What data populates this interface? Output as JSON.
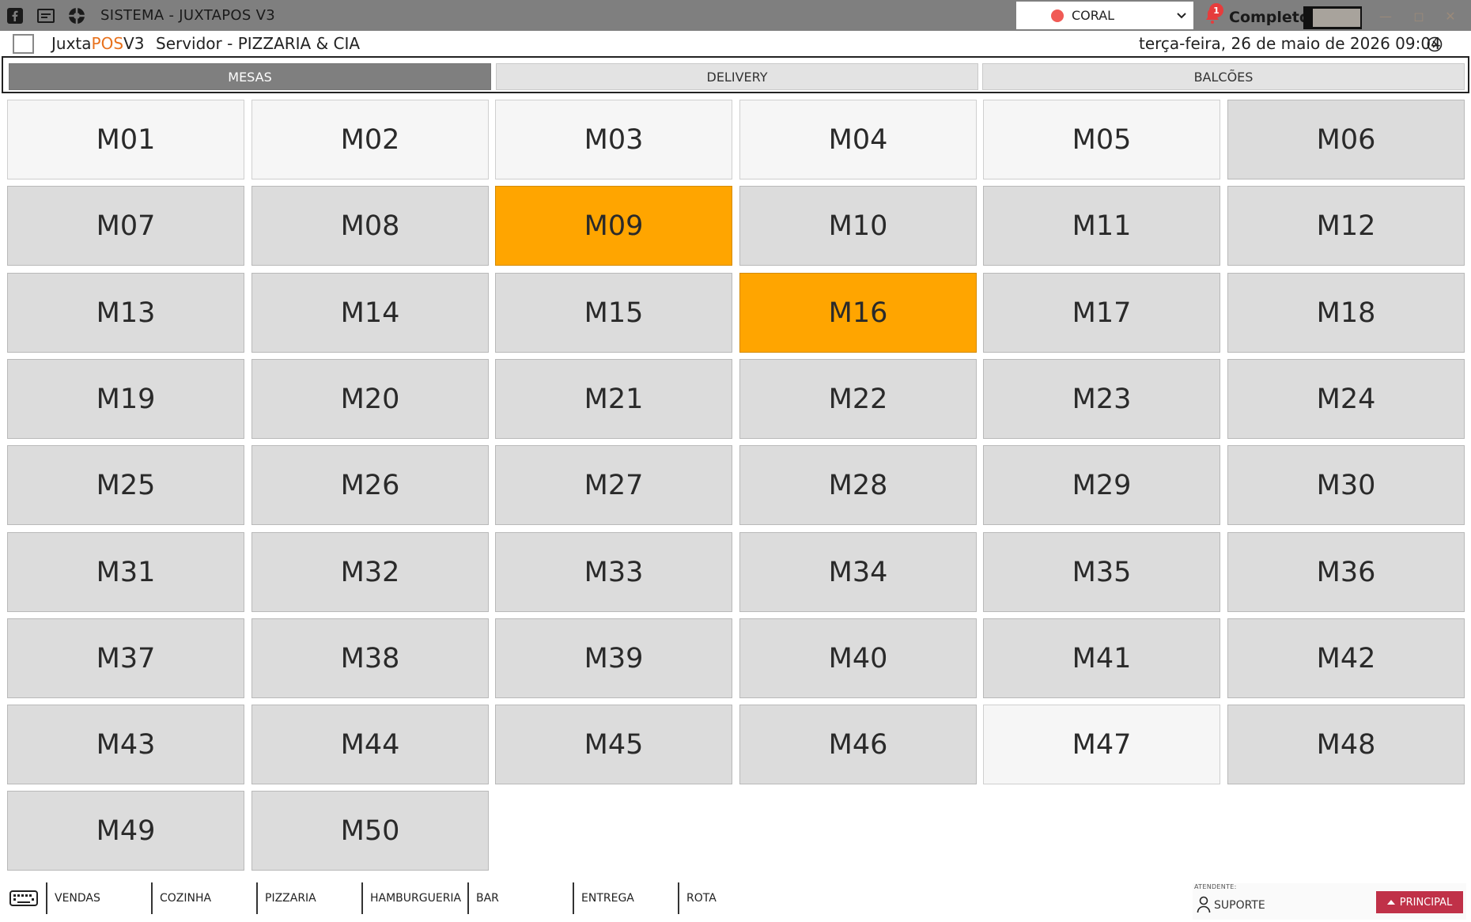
{
  "window": {
    "title": "SISTEMA - JUXTAPOS V3",
    "store_select": "CORAL",
    "notification_count": "1",
    "mode_label": "Completo"
  },
  "header": {
    "app_name_prefix": "Juxta",
    "app_name_highlight": "POS",
    "app_name_suffix": "V3",
    "server": "Servidor - PIZZARIA & CIA",
    "datetime": "terça-feira, 26 de maio de 2026 09:04"
  },
  "tabs": [
    {
      "label": "MESAS",
      "active": true
    },
    {
      "label": "DELIVERY",
      "active": false
    },
    {
      "label": "BALCÕES",
      "active": false
    }
  ],
  "tables": [
    {
      "label": "M01",
      "status": "free"
    },
    {
      "label": "M02",
      "status": "free"
    },
    {
      "label": "M03",
      "status": "free"
    },
    {
      "label": "M04",
      "status": "free"
    },
    {
      "label": "M05",
      "status": "free"
    },
    {
      "label": "M06",
      "status": "normal"
    },
    {
      "label": "M07",
      "status": "normal"
    },
    {
      "label": "M08",
      "status": "normal"
    },
    {
      "label": "M09",
      "status": "busy"
    },
    {
      "label": "M10",
      "status": "normal"
    },
    {
      "label": "M11",
      "status": "normal"
    },
    {
      "label": "M12",
      "status": "normal"
    },
    {
      "label": "M13",
      "status": "normal"
    },
    {
      "label": "M14",
      "status": "normal"
    },
    {
      "label": "M15",
      "status": "normal"
    },
    {
      "label": "M16",
      "status": "busy"
    },
    {
      "label": "M17",
      "status": "normal"
    },
    {
      "label": "M18",
      "status": "normal"
    },
    {
      "label": "M19",
      "status": "normal"
    },
    {
      "label": "M20",
      "status": "normal"
    },
    {
      "label": "M21",
      "status": "normal"
    },
    {
      "label": "M22",
      "status": "normal"
    },
    {
      "label": "M23",
      "status": "normal"
    },
    {
      "label": "M24",
      "status": "normal"
    },
    {
      "label": "M25",
      "status": "normal"
    },
    {
      "label": "M26",
      "status": "normal"
    },
    {
      "label": "M27",
      "status": "normal"
    },
    {
      "label": "M28",
      "status": "normal"
    },
    {
      "label": "M29",
      "status": "normal"
    },
    {
      "label": "M30",
      "status": "normal"
    },
    {
      "label": "M31",
      "status": "normal"
    },
    {
      "label": "M32",
      "status": "normal"
    },
    {
      "label": "M33",
      "status": "normal"
    },
    {
      "label": "M34",
      "status": "normal"
    },
    {
      "label": "M35",
      "status": "normal"
    },
    {
      "label": "M36",
      "status": "normal"
    },
    {
      "label": "M37",
      "status": "normal"
    },
    {
      "label": "M38",
      "status": "normal"
    },
    {
      "label": "M39",
      "status": "normal"
    },
    {
      "label": "M40",
      "status": "normal"
    },
    {
      "label": "M41",
      "status": "normal"
    },
    {
      "label": "M42",
      "status": "normal"
    },
    {
      "label": "M43",
      "status": "normal"
    },
    {
      "label": "M44",
      "status": "normal"
    },
    {
      "label": "M45",
      "status": "normal"
    },
    {
      "label": "M46",
      "status": "normal"
    },
    {
      "label": "M47",
      "status": "free"
    },
    {
      "label": "M48",
      "status": "normal"
    },
    {
      "label": "M49",
      "status": "normal"
    },
    {
      "label": "M50",
      "status": "normal"
    }
  ],
  "bottom_nav": [
    "VENDAS",
    "COZINHA",
    "PIZZARIA",
    "HAMBURGUERIA",
    "BAR",
    "ENTREGA",
    "ROTA"
  ],
  "attendant": {
    "label": "ATENDENTE:",
    "name": "SUPORTE",
    "principal_button": "PRINCIPAL"
  },
  "colors": {
    "titlebar": "#7f7f7f",
    "table_normal": "#dcdcdc",
    "table_free": "#f6f6f6",
    "table_busy": "#ffa500",
    "accent_pos": "#e8711c",
    "principal": "#c03148",
    "status_dot": "#f05a55"
  },
  "icons": [
    "facebook-icon",
    "message-icon",
    "support-icon",
    "bell-icon",
    "chevron-down-icon",
    "clock-icon",
    "keyboard-icon",
    "user-icon",
    "caret-up-icon"
  ]
}
